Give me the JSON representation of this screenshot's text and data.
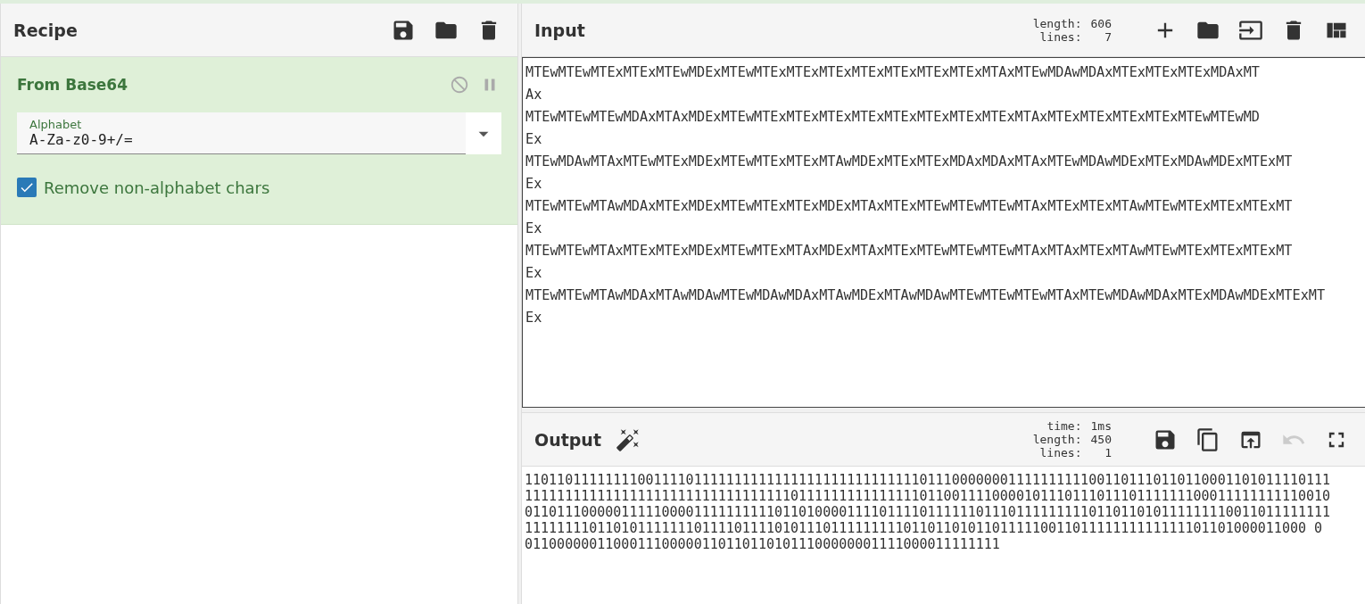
{
  "recipe": {
    "title": "Recipe",
    "operations": [
      {
        "name": "From Base64",
        "args": [
          {
            "kind": "dropdown",
            "label": "Alphabet",
            "value": "A-Za-z0-9+/="
          },
          {
            "kind": "checkbox",
            "label": "Remove non-alphabet chars",
            "checked": true
          }
        ]
      }
    ]
  },
  "input": {
    "title": "Input",
    "stats": [
      {
        "label": "length:",
        "value": "606"
      },
      {
        "label": "lines:",
        "value": "7"
      }
    ],
    "lines": [
      "MTEwMTEwMTExMTExMTEwMDExMTEwMTExMTExMTExMTExMTExMTExMTExMTAxMTEwMDAwMDAxMTExMTExMTExMDAxMT",
      "Ax",
      "MTEwMTEwMTEwMDAxMTAxMDExMTEwMTExMTExMTExMTExMTExMTExMTExMTExMTAxMTExMTExMTExMTExMTEwMTEwMD",
      "Ex",
      "MTEwMDAwMTAxMTEwMTExMDExMTEwMTExMTExMTAwMDExMTExMTExMDAxMDAxMTAxMTEwMDAwMDExMTExMDAwMDExMTExMT",
      "Ex",
      "MTEwMTEwMTAwMDAxMTExMDExMTEwMTExMTExMDExMTAxMTExMTEwMTEwMTEwMTAxMTExMTExMTAwMTEwMTExMTExMTExMT",
      "Ex",
      "MTEwMTEwMTAxMTExMTExMDExMTEwMTExMTAxMDExMTAxMTExMTEwMTEwMTEwMTAxMTAxMTExMTAwMTEwMTExMTExMTExMT",
      "Ex",
      "MTEwMTEwMTAwMDAxMTAwMDAwMTEwMDAwMDAxMTAwMDExMTAwMDAwMTEwMTEwMTEwMTAxMTEwMDAwMDAxMTExMDAwMDExMTExMT",
      "Ex"
    ]
  },
  "output": {
    "title": "Output",
    "stats": [
      {
        "label": "time:",
        "value": "1ms"
      },
      {
        "label": "length:",
        "value": "450"
      },
      {
        "label": "lines:",
        "value": "1"
      }
    ],
    "undo": {
      "disabled": true
    },
    "lines": [
      "1101101111111100111101111111111111111111111111111011100000001111111111001101110110110001101011110111",
      "1111111111111111111111111111111110111111111111111011001111000010111011101110111111100011111111110010",
      "0110111000001111100001111111111011010000111101111011111101110111111111011011010111111110011011111111",
      "1111111101101011111110111101111010111011111111101101101011011111001101111111111111101101000011000 0",
      "01100000011000111000001101101101011100000001111000011111111"
    ]
  }
}
